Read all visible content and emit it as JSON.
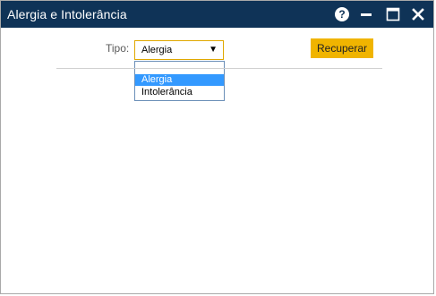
{
  "window": {
    "title": "Alergia e Intolerância",
    "controls": {
      "help_glyph": "?",
      "help_icon": "question-circle-icon",
      "minimize_icon": "minimize-icon",
      "maximize_icon": "maximize-icon",
      "close_icon": "close-icon"
    },
    "titlebar_color": "#0f3357"
  },
  "form": {
    "tipo_label": "Tipo:",
    "tipo_select": {
      "selected": "Alergia",
      "arrow_icon": "caret-down-icon",
      "options": [
        "",
        "Alergia",
        "Intolerância"
      ],
      "highlighted": "Alergia"
    },
    "recuperar_label": "Recuperar",
    "accent_color": "#f0b400",
    "highlight_color": "#3399ff"
  }
}
